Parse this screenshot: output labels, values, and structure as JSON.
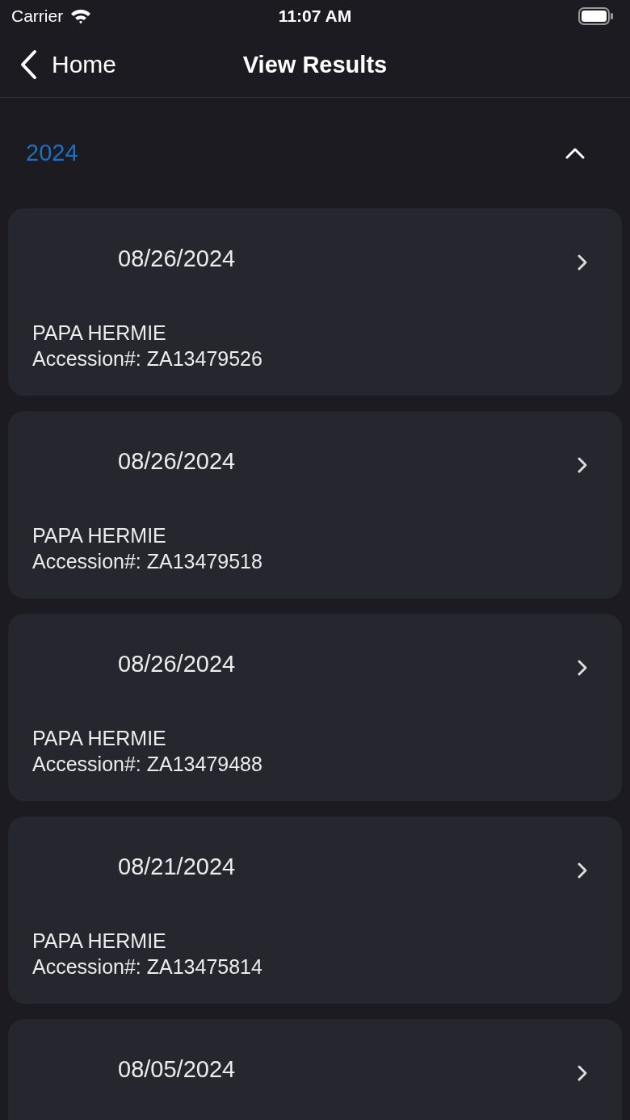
{
  "status_bar": {
    "carrier": "Carrier",
    "time": "11:07 AM"
  },
  "nav": {
    "back_label": "Home",
    "title": "View Results"
  },
  "section": {
    "year": "2024",
    "expanded": true
  },
  "results": [
    {
      "date": "08/26/2024",
      "patient": "PAPA HERMIE",
      "accession": "Accession#: ZA13479526"
    },
    {
      "date": "08/26/2024",
      "patient": "PAPA HERMIE",
      "accession": "Accession#: ZA13479518"
    },
    {
      "date": "08/26/2024",
      "patient": "PAPA HERMIE",
      "accession": "Accession#: ZA13479488"
    },
    {
      "date": "08/21/2024",
      "patient": "PAPA HERMIE",
      "accession": "Accession#: ZA13475814"
    },
    {
      "date": "08/05/2024"
    }
  ]
}
